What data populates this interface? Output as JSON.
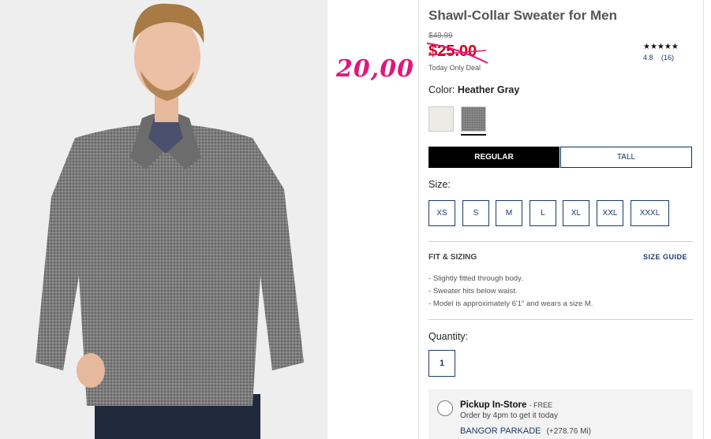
{
  "product": {
    "title": "Shawl-Collar Sweater for Men",
    "original_price": "$49.99",
    "sale_price": "$25.00",
    "deal_note": "Today Only Deal",
    "annotation_price": "20,00",
    "stars": "★★★★★",
    "rating_value": "4.8",
    "rating_count": "(16)"
  },
  "color": {
    "label": "Color:",
    "selected": "Heather Gray",
    "swatches": [
      {
        "name": "cream",
        "hex": "#ecebe6"
      },
      {
        "name": "heather-gray",
        "hex": "#8a8a8a"
      }
    ]
  },
  "fit_options": {
    "regular": "REGULAR",
    "tall": "TALL",
    "selected": "REGULAR"
  },
  "size": {
    "label": "Size:",
    "options": [
      "XS",
      "S",
      "M",
      "L",
      "XL",
      "XXL",
      "XXXL"
    ]
  },
  "fit_sizing": {
    "heading": "FIT & SIZING",
    "size_guide": "SIZE GUIDE",
    "bullets": [
      "Slightly fitted through body.",
      "Sweater hits below waist.",
      "Model is approximately 6'1\" and wears a size M."
    ]
  },
  "quantity": {
    "label": "Quantity:",
    "value": "1"
  },
  "pickup": {
    "title": "Pickup In-Store",
    "free": "- FREE",
    "note": "Order by 4pm to get it today",
    "store": "BANGOR PARKADE",
    "distance": "(+278.76 Mi)"
  },
  "colors": {
    "sale_red": "#d0021b",
    "annotation_pink": "#e0187c",
    "navy": "#1a3a6b"
  }
}
